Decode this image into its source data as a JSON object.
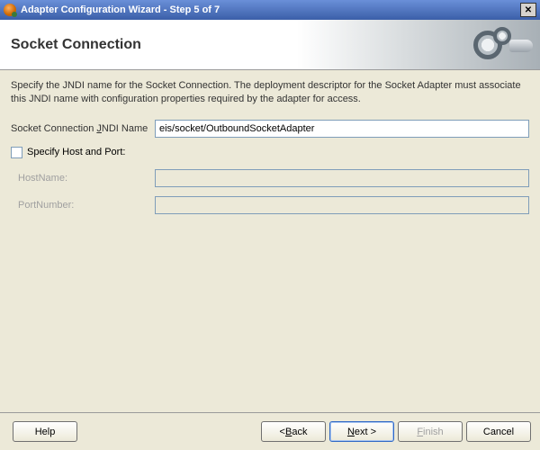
{
  "window": {
    "title": "Adapter Configuration Wizard - Step 5 of 7"
  },
  "header": {
    "title": "Socket Connection"
  },
  "description": "Specify the JNDI name for the Socket Connection.  The deployment descriptor for the Socket Adapter must associate this JNDI name with configuration properties required by the adapter for access.",
  "fields": {
    "jndi_label_pre": "Socket Connection ",
    "jndi_mnemonic": "J",
    "jndi_label_post": "NDI Name",
    "jndi_value": "eis/socket/OutboundSocketAdapter",
    "specify_label": "Specify Host and Port:",
    "specify_checked": false,
    "hostname_label": "HostName:",
    "hostname_value": "",
    "portnumber_label": "PortNumber:",
    "portnumber_value": ""
  },
  "buttons": {
    "help": "Help",
    "back_mnemonic": "B",
    "back_rest": "ack",
    "next_mnemonic": "N",
    "next_rest": "ext >",
    "finish_mnemonic": "F",
    "finish_rest": "inish",
    "cancel": "Cancel"
  }
}
